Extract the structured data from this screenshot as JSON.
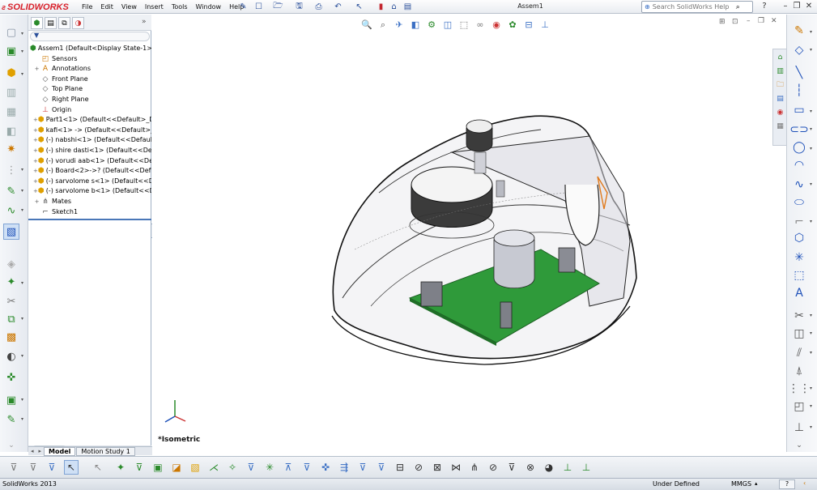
{
  "app": {
    "logo_text": "SOLIDWORKS",
    "doc_title": "Assem1"
  },
  "menu": [
    "File",
    "Edit",
    "View",
    "Insert",
    "Tools",
    "Window",
    "Help"
  ],
  "search": {
    "placeholder": "Search SolidWorks Help"
  },
  "feature_tree": {
    "items": [
      {
        "label": "Assem1  (Default<Display State-1>)",
        "icon": "assembly-icon",
        "level": 0,
        "expand": ""
      },
      {
        "label": "Sensors",
        "icon": "sensors-icon",
        "level": 1,
        "expand": ""
      },
      {
        "label": "Annotations",
        "icon": "annotations-icon",
        "level": 1,
        "expand": "+"
      },
      {
        "label": "Front Plane",
        "icon": "plane-icon",
        "level": 1,
        "expand": ""
      },
      {
        "label": "Top Plane",
        "icon": "plane-icon",
        "level": 1,
        "expand": ""
      },
      {
        "label": "Right Plane",
        "icon": "plane-icon",
        "level": 1,
        "expand": ""
      },
      {
        "label": "Origin",
        "icon": "origin-icon",
        "level": 1,
        "expand": ""
      },
      {
        "label": "Part1<1> (Default<<Default>_Di",
        "icon": "part-icon",
        "level": 1,
        "expand": "+"
      },
      {
        "label": "kafi<1> -> (Default<<Default>_I",
        "icon": "part-icon",
        "level": 1,
        "expand": "+"
      },
      {
        "label": "(-) nabshi<1> (Default<<Default",
        "icon": "part-icon",
        "level": 1,
        "expand": "+"
      },
      {
        "label": "(-) shire dasti<1> (Default<<Def",
        "icon": "part-icon",
        "level": 1,
        "expand": "+"
      },
      {
        "label": "(-) vorudi aab<1> (Default<<Def",
        "icon": "part-icon",
        "level": 1,
        "expand": "+"
      },
      {
        "label": "(-) Board<2>->? (Default<<Defa",
        "icon": "part-icon",
        "level": 1,
        "expand": "+"
      },
      {
        "label": "(-) sarvolome s<1> (Default<<De",
        "icon": "part-icon",
        "level": 1,
        "expand": "+"
      },
      {
        "label": "(-) sarvolome b<1> (Default<<D",
        "icon": "part-icon",
        "level": 1,
        "expand": "+"
      },
      {
        "label": "Mates",
        "icon": "mates-icon",
        "level": 1,
        "expand": "+"
      },
      {
        "label": "Sketch1",
        "icon": "sketch-icon",
        "level": 1,
        "expand": ""
      }
    ]
  },
  "bottom_tabs": [
    "Model",
    "Motion Study 1"
  ],
  "view_label": "*Isometric",
  "status": {
    "app_version": "SolidWorks 2013",
    "state": "Under Defined",
    "units": "MMGS"
  },
  "colors": {
    "pcb": "#2f9a3a",
    "accent": "#1c4fb8"
  }
}
